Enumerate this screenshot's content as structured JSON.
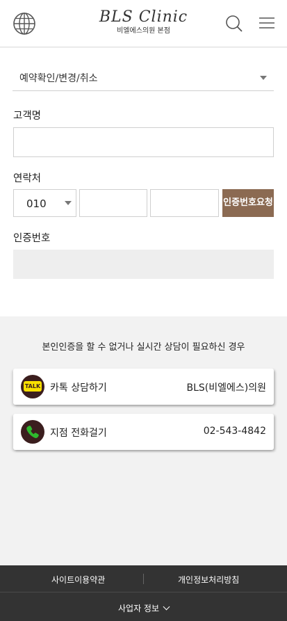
{
  "header": {
    "logo": "BLS Clinic",
    "logo_sub": "비엘에스의원 본점"
  },
  "form": {
    "service_select": "예약확인/변경/취소",
    "name_label": "고객명",
    "name_value": "",
    "phone_label": "연락처",
    "phone_prefix": "010",
    "phone_mid": "",
    "phone_last": "",
    "request_code_button": "인증번호요청",
    "code_label": "인증번호",
    "code_value": ""
  },
  "help": {
    "notice": "본인인증을 할 수 없거나 실시간 상담이 필요하신 경우",
    "kakao": {
      "icon_text": "TALK",
      "title": "카톡 상담하기",
      "right": "BLS(비엘에스)의원"
    },
    "call": {
      "title": "지점 전화걸기",
      "right": "02-543-4842"
    }
  },
  "footer": {
    "terms": "사이트이용약관",
    "privacy": "개인정보처리방침",
    "business_info": "사업자 정보"
  },
  "colors": {
    "accent": "#8b6a52",
    "footer_bg": "#333333",
    "kakao_yellow": "#f9e000",
    "phone_green": "#2eb82e"
  },
  "icons": [
    "globe-icon",
    "search-icon",
    "menu-icon",
    "kakao-talk-icon",
    "phone-icon",
    "chevron-down-icon"
  ]
}
